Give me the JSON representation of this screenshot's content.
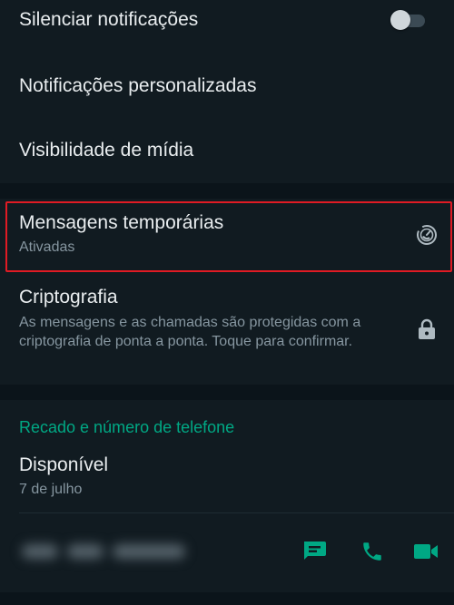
{
  "notifications": {
    "mute_label": "Silenciar notificações",
    "mute_enabled": false,
    "custom_label": "Notificações personalizadas",
    "media_label": "Visibilidade de mídia"
  },
  "disappearing": {
    "title": "Mensagens temporárias",
    "status": "Ativadas",
    "icon": "timer-icon"
  },
  "encryption": {
    "title": "Criptografia",
    "description": "As mensagens e as chamadas são protegidas com a criptografia de ponta a ponta. Toque para confirmar.",
    "icon": "lock-icon"
  },
  "about": {
    "header": "Recado e número de telefone",
    "status": "Disponível",
    "date": "7 de julho",
    "actions": {
      "message_icon": "message-icon",
      "call_icon": "phone-icon",
      "video_icon": "video-call-icon"
    }
  },
  "colors": {
    "background": "#0b141a",
    "panel": "#111b21",
    "accent": "#00a884",
    "highlight_border": "#e01b24"
  }
}
